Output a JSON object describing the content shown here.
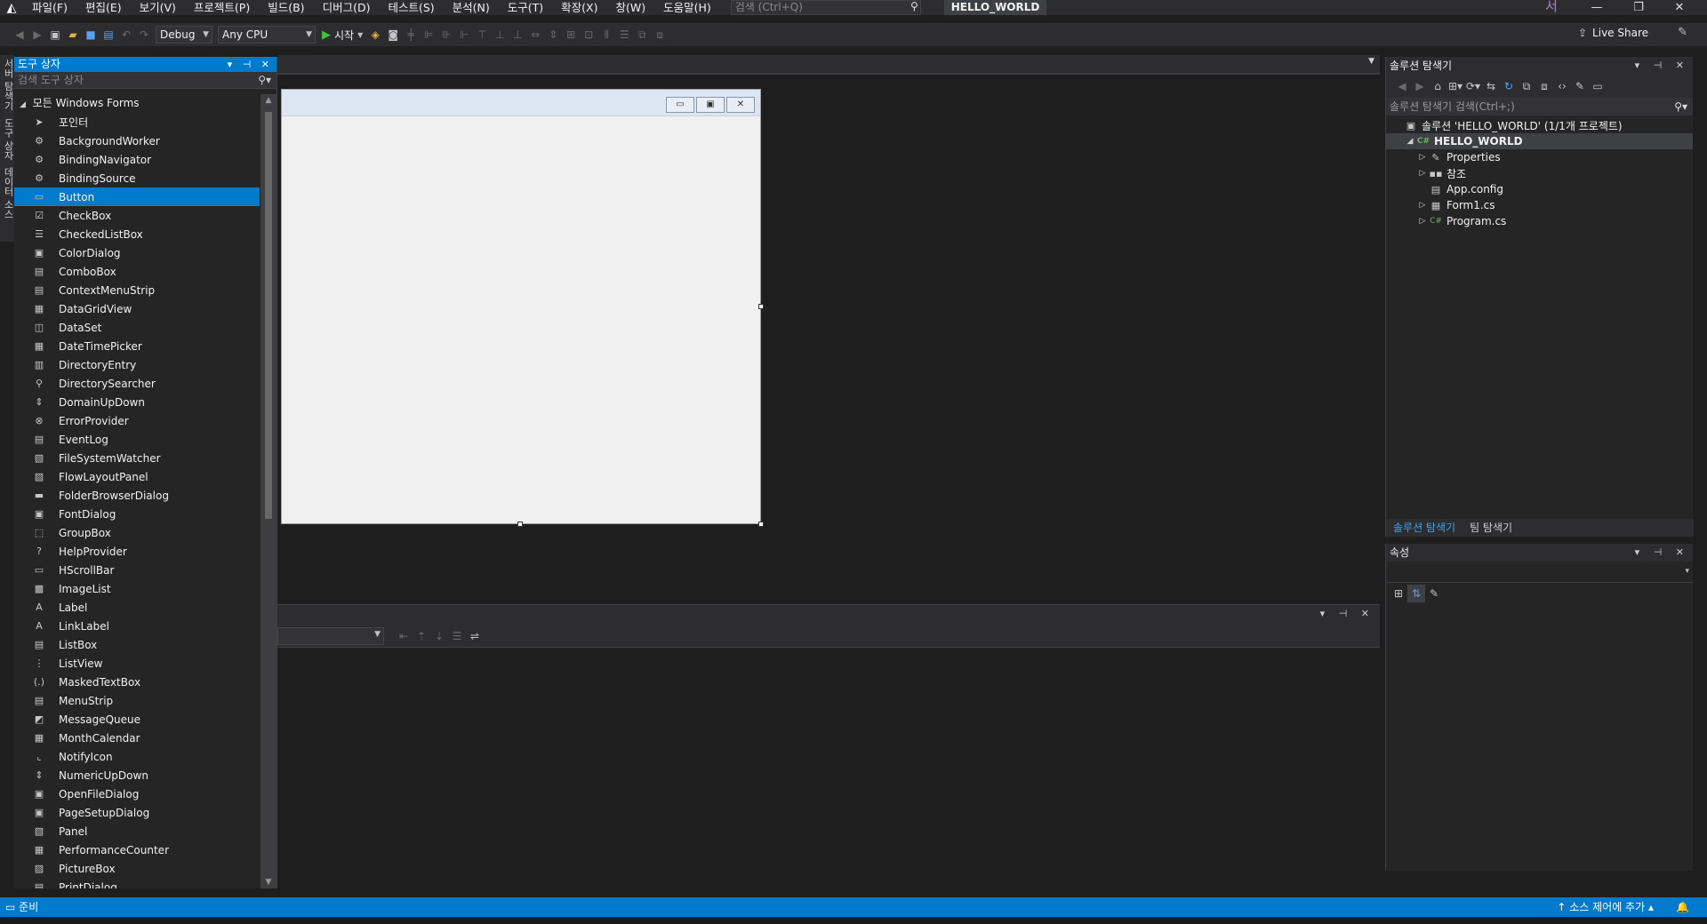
{
  "menubar": {
    "items": [
      "파일(F)",
      "편집(E)",
      "보기(V)",
      "프로젝트(P)",
      "빌드(B)",
      "디버그(D)",
      "테스트(S)",
      "분석(N)",
      "도구(T)",
      "확장(X)",
      "창(W)",
      "도움말(H)"
    ],
    "search_placeholder": "검색 (Ctrl+Q)",
    "solution_name": "HELLO_WORLD",
    "user_initial": "서"
  },
  "toolbar": {
    "configuration": "Debug",
    "platform": "Any CPU",
    "start_label": "시작",
    "live_share": "Live Share"
  },
  "side_tabs": [
    "서버 탐색기",
    "도구 상자",
    "데이터 소스"
  ],
  "toolbox": {
    "title": "도구 상자",
    "search_placeholder": "검색 도구 상자",
    "group": "모든 Windows Forms",
    "items": [
      {
        "label": "포인터",
        "icon": "pointer-icon"
      },
      {
        "label": "BackgroundWorker",
        "icon": "component-icon"
      },
      {
        "label": "BindingNavigator",
        "icon": "component-icon"
      },
      {
        "label": "BindingSource",
        "icon": "component-icon"
      },
      {
        "label": "Button",
        "icon": "button-icon"
      },
      {
        "label": "CheckBox",
        "icon": "checkbox-icon"
      },
      {
        "label": "CheckedListBox",
        "icon": "list-icon"
      },
      {
        "label": "ColorDialog",
        "icon": "dialog-icon"
      },
      {
        "label": "ComboBox",
        "icon": "combo-icon"
      },
      {
        "label": "ContextMenuStrip",
        "icon": "menu-icon"
      },
      {
        "label": "DataGridView",
        "icon": "grid-icon"
      },
      {
        "label": "DataSet",
        "icon": "dataset-icon"
      },
      {
        "label": "DateTimePicker",
        "icon": "calendar-icon"
      },
      {
        "label": "DirectoryEntry",
        "icon": "directory-icon"
      },
      {
        "label": "DirectorySearcher",
        "icon": "search-icon"
      },
      {
        "label": "DomainUpDown",
        "icon": "updown-icon"
      },
      {
        "label": "ErrorProvider",
        "icon": "error-icon"
      },
      {
        "label": "EventLog",
        "icon": "log-icon"
      },
      {
        "label": "FileSystemWatcher",
        "icon": "watcher-icon"
      },
      {
        "label": "FlowLayoutPanel",
        "icon": "panel-icon"
      },
      {
        "label": "FolderBrowserDialog",
        "icon": "folder-icon"
      },
      {
        "label": "FontDialog",
        "icon": "dialog-icon"
      },
      {
        "label": "GroupBox",
        "icon": "groupbox-icon"
      },
      {
        "label": "HelpProvider",
        "icon": "help-icon"
      },
      {
        "label": "HScrollBar",
        "icon": "scrollbar-icon"
      },
      {
        "label": "ImageList",
        "icon": "imagelist-icon"
      },
      {
        "label": "Label",
        "icon": "label-icon"
      },
      {
        "label": "LinkLabel",
        "icon": "linklabel-icon"
      },
      {
        "label": "ListBox",
        "icon": "listbox-icon"
      },
      {
        "label": "ListView",
        "icon": "listview-icon"
      },
      {
        "label": "MaskedTextBox",
        "icon": "masked-icon"
      },
      {
        "label": "MenuStrip",
        "icon": "menu-icon"
      },
      {
        "label": "MessageQueue",
        "icon": "queue-icon"
      },
      {
        "label": "MonthCalendar",
        "icon": "calendar-icon"
      },
      {
        "label": "NotifyIcon",
        "icon": "notify-icon"
      },
      {
        "label": "NumericUpDown",
        "icon": "updown-icon"
      },
      {
        "label": "OpenFileDialog",
        "icon": "dialog-icon"
      },
      {
        "label": "PageSetupDialog",
        "icon": "dialog-icon"
      },
      {
        "label": "Panel",
        "icon": "panel-icon"
      },
      {
        "label": "PerformanceCounter",
        "icon": "counter-icon"
      },
      {
        "label": "PictureBox",
        "icon": "picture-icon"
      },
      {
        "label": "PrintDialog",
        "icon": "print-icon"
      }
    ],
    "selected_index": 4
  },
  "solution_explorer": {
    "title": "솔루션 탐색기",
    "search_placeholder": "솔루션 탐색기 검색(Ctrl+;)",
    "tree": [
      {
        "label": "솔루션 'HELLO_WORLD' (1/1개 프로젝트)",
        "icon": "solution-icon",
        "indent": 0,
        "arrow": ""
      },
      {
        "label": "HELLO_WORLD",
        "icon": "csharp-project-icon",
        "indent": 1,
        "arrow": "◢",
        "selected": true
      },
      {
        "label": "Properties",
        "icon": "wrench-icon",
        "indent": 2,
        "arrow": "▷"
      },
      {
        "label": "참조",
        "icon": "references-icon",
        "indent": 2,
        "arrow": "▷"
      },
      {
        "label": "App.config",
        "icon": "config-icon",
        "indent": 2,
        "arrow": ""
      },
      {
        "label": "Form1.cs",
        "icon": "form-icon",
        "indent": 2,
        "arrow": "▷"
      },
      {
        "label": "Program.cs",
        "icon": "csharp-file-icon",
        "indent": 2,
        "arrow": "▷"
      }
    ],
    "tabs": [
      "솔루션 탐색기",
      "팀 탐색기"
    ]
  },
  "properties": {
    "title": "속성"
  },
  "statusbar": {
    "text": "준비",
    "source_control": "소스 제어에 추가"
  },
  "colors": {
    "accent": "#007acc",
    "background": "#1e1e1e",
    "panel": "#252526",
    "chrome": "#2d2d30"
  }
}
